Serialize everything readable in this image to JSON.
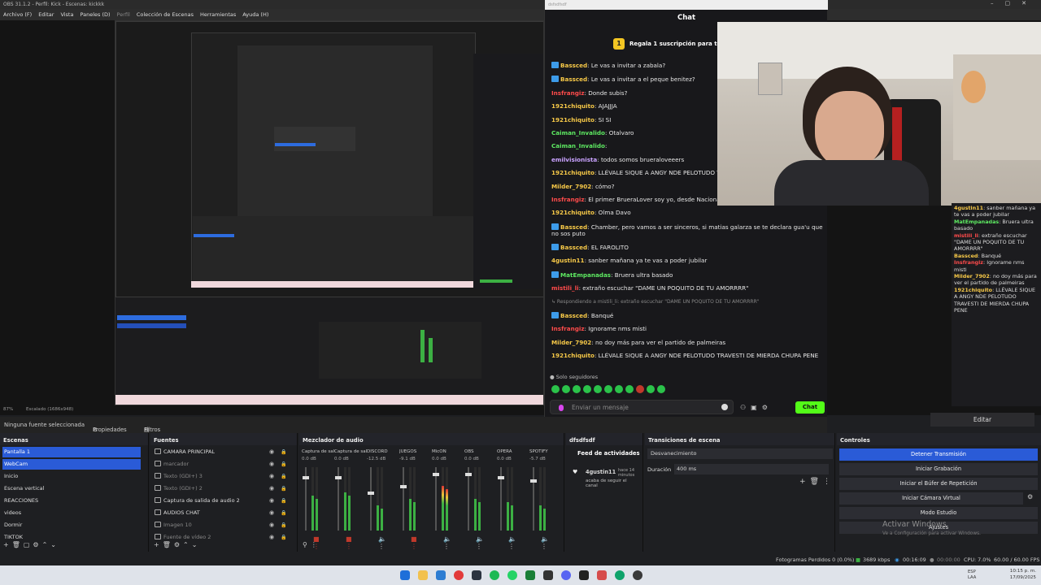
{
  "window": {
    "title": "OBS 31.1.2 - Perfil: Kick - Escenas: kickkk"
  },
  "menu": [
    "Archivo (F)",
    "Editar",
    "Vista",
    "Paneles (D)",
    "Perfil",
    "Colección de Escenas",
    "Herramientas",
    "Ayuda (H)"
  ],
  "chat": {
    "title": "Chat",
    "gift_text": "Regala 1 suscripción para tomar",
    "gift_badge": "1",
    "messages": [
      {
        "user": "Bassced",
        "text": ": Le vas a invitar a zabala?",
        "color": "#f7c948",
        "badge": true
      },
      {
        "user": "Bassced",
        "text": ": Le vas a invitar a el peque benitez?",
        "color": "#f7c948",
        "badge": true
      },
      {
        "user": "Insfrangiz",
        "text": ": Donde subis?",
        "color": "#ff4b4b",
        "badge": false
      },
      {
        "user": "1921chiquito",
        "text": ": AJAJJJA",
        "color": "#f7c948",
        "badge": false
      },
      {
        "user": "1921chiquito",
        "text": ": SI SI",
        "color": "#f7c948",
        "badge": false
      },
      {
        "user": "Caiman_Invalido",
        "text": ": Otalvaro",
        "color": "#5eea62",
        "badge": false
      },
      {
        "user": "Caiman_Invalido",
        "text": ":",
        "color": "#5eea62",
        "badge": false
      },
      {
        "user": "emilvisionista",
        "text": ": todos somos brueraloveeers",
        "color": "#c9a2ff",
        "badge": false
      },
      {
        "user": "1921chiquito",
        "text": ": LLÉVALE SIQUE A ANGY NDE PELOTUDO TRA",
        "color": "#f7c948",
        "badge": false
      },
      {
        "user": "Milder_7902",
        "text": ": cómo?",
        "color": "#f7c948",
        "badge": false
      },
      {
        "user": "Insfrangiz",
        "text": ": El primer BrueraLover soy yo, desde Nacional",
        "color": "#ff4b4b",
        "badge": false
      },
      {
        "user": "1921chiquito",
        "text": ": Olma Davo",
        "color": "#f7c948",
        "badge": false
      },
      {
        "user": "Bassced",
        "text": ": Chamber, pero vamos a ser sinceros, si matias galarza se te declara gua'u que no sos puto",
        "color": "#f7c948",
        "badge": true
      },
      {
        "user": "Bassced",
        "text": ": EL FAROLITO",
        "color": "#f7c948",
        "badge": true
      },
      {
        "user": "4gustin11",
        "text": ": sanber mañana ya te vas a poder jubilar",
        "color": "#f7c948",
        "badge": false
      },
      {
        "user": "MatEmpanadas",
        "text": ": Bruera ultra basado",
        "color": "#5eea62",
        "badge": true
      },
      {
        "user": "mistili_li",
        "text": ": extraño escuchar \"DAME UN POQUITO DE TU AMORRRR\"",
        "color": "#ff4b4b",
        "badge": false
      },
      {
        "user": "Bassced",
        "text": ": Banqué",
        "color": "#f7c948",
        "badge": true
      },
      {
        "user": "Insfrangiz",
        "text": ": Ignorame nms misti",
        "color": "#ff4b4b",
        "badge": false
      },
      {
        "user": "Milder_7902",
        "text": ": no doy más para ver el partido de palmeiras",
        "color": "#f7c948",
        "badge": false
      },
      {
        "user": "1921chiquito",
        "text": ": LLÉVALE SIQUE A ANGY NDE PELOTUDO TRAVESTI DE MIERDA CHUPA PENE",
        "color": "#f7c948",
        "badge": false
      }
    ],
    "reply_hint": "Respondiendo a mistili_li: extraño escuchar \"DAME UN POQUITO DE TU AMORRRR\"",
    "solo_seguidores": "Solo seguidores",
    "input_placeholder": "Enviar un mensaje",
    "send_label": "Chat"
  },
  "right_chat": [
    {
      "user": "4gustin11",
      "text": ": sanber mañana ya te vas a poder jubilar",
      "color": "#f7c948"
    },
    {
      "user": "MatEmpanadas",
      "text": ": Bruera ultra basado",
      "color": "#5eea62"
    },
    {
      "user": "mistili_li",
      "text": ": extraño escuchar \"DAME UN POQUITO DE TU AMORRRR\"",
      "color": "#ff4b4b"
    },
    {
      "user": "Bassced",
      "text": ": Banqué",
      "color": "#f7c948"
    },
    {
      "user": "Insfrangiz",
      "text": ": Ignorame nms misti",
      "color": "#ff4b4b"
    },
    {
      "user": "Milder_7902",
      "text": ": no doy más para ver el partido de palmeiras",
      "color": "#f7c948"
    },
    {
      "user": "1921chiquito",
      "text": ": LLÉVALE SIQUE A ANGY NDE PELOTUDO TRAVESTI DE MIERDA CHUPA PENE",
      "color": "#f7c948"
    }
  ],
  "right_edit": "Editar",
  "preview_bar": {
    "zoom": "87%",
    "scaled": "Escalado (1686x948)"
  },
  "props_bar": {
    "no_source": "Ninguna fuente seleccionada",
    "properties": "Propiedades",
    "filters": "Filtros"
  },
  "scenes": {
    "title": "Escenas",
    "items": [
      "Pantalla 1",
      "WebCam",
      "Inicio",
      "Escena vertical",
      "REACCIONES",
      "videos",
      "Dormir",
      "TIKTOK"
    ],
    "selected": [
      0,
      1
    ]
  },
  "sources": {
    "title": "Fuentes",
    "items": [
      "CAMARA PRINCIPAL",
      "marcador",
      "Texto (GDI+) 3",
      "Texto (GDI+) 2",
      "Captura de salida de audio 2",
      "AUDIOS CHAT",
      "Imagen 10",
      "Fuente de vídeo 2"
    ]
  },
  "mixer": {
    "title": "Mezclador de audio",
    "tracks": [
      {
        "name": "Captura de salida d",
        "db": "0.0 dB",
        "level": 0.55,
        "fader": 0.85,
        "muted": true
      },
      {
        "name": "Captura de salida d",
        "db": "0.0 dB",
        "level": 0.6,
        "fader": 0.85,
        "muted": true
      },
      {
        "name": "DISCORD",
        "db": "-12.5 dB",
        "level": 0.4,
        "fader": 0.6,
        "muted": false
      },
      {
        "name": "JUEGOS",
        "db": "-9.1 dB",
        "level": 0.5,
        "fader": 0.7,
        "muted": true
      },
      {
        "name": "MicON",
        "db": "0.0 dB",
        "level": 0.7,
        "fader": 0.9,
        "muted": false
      },
      {
        "name": "OBS",
        "db": "0.0 dB",
        "level": 0.5,
        "fader": 0.9,
        "muted": false
      },
      {
        "name": "OPERA",
        "db": "0.0 dB",
        "level": 0.45,
        "fader": 0.85,
        "muted": false
      },
      {
        "name": "SPOTIFY",
        "db": "-5.7 dB",
        "level": 0.4,
        "fader": 0.8,
        "muted": false
      }
    ]
  },
  "activity": {
    "title": "dfsdfsdf",
    "feed_title": "Feed de actividades",
    "user": "4gustin11",
    "action": "acaba de seguir el canal",
    "time": "hace 14 minutos"
  },
  "transitions": {
    "title": "Transiciones de escena",
    "selected": "Desvanecimiento",
    "duration_label": "Duración",
    "duration_value": "400 ms"
  },
  "controls": {
    "title": "Controles",
    "buttons": [
      "Detener Transmisión",
      "Iniciar Grabación",
      "Iniciar el Búfer de Repetición",
      "Iniciar Cámara Virtual",
      "Modo Estudio",
      "Ajustes"
    ]
  },
  "status": {
    "frames": "Fotogramas Perdidos 0 (0.0%)",
    "bitrate": "3689 kbps",
    "stream_time": "00:16:09",
    "rec_time": "00:00:00",
    "cpu": "CPU: 7.0%",
    "fps": "60.00 / 60.00 FPS"
  },
  "watermark": {
    "line1": "Activar Windows",
    "line2": "Ve a Configuración para activar Windows."
  },
  "tray": {
    "lang": "ESP LAA",
    "time": "10:15 p. m.",
    "date": "17/09/2025"
  },
  "colors": {
    "accent": "#2a5bd7",
    "kick_green": "#53fc18"
  }
}
